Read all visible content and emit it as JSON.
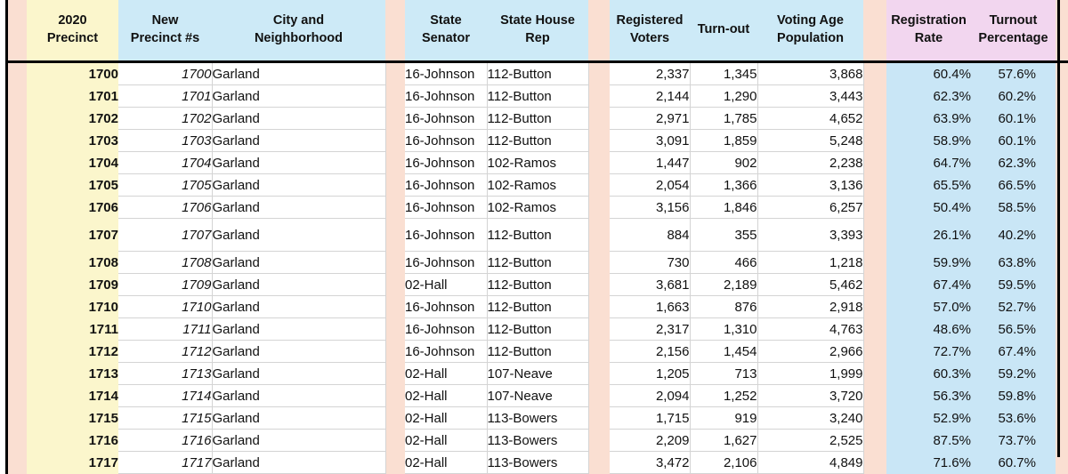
{
  "table": {
    "headers": {
      "precinct_2020": "2020\nPrecinct",
      "precinct_2020_l1": "2020",
      "precinct_2020_l2": "Precinct",
      "new_precinct_l1": "New",
      "new_precinct_l2": "Precinct #s",
      "city_l1": "City and",
      "city_l2": "Neighborhood",
      "state_senator": "State Senator",
      "state_house_rep": "State House Rep",
      "registered_voters_l1": "Registered",
      "registered_voters_l2": "Voters",
      "turnout": "Turn-out",
      "vap_l1": "Voting Age",
      "vap_l2": "Population",
      "registration_rate_l1": "Registration",
      "registration_rate_l2": "Rate",
      "turnout_pct_l1": "Turnout",
      "turnout_pct_l2": "Percentage"
    },
    "columns": [
      "2020 Precinct",
      "New Precinct #s",
      "City and Neighborhood",
      "State Senator",
      "State House Rep",
      "Registered Voters",
      "Turn-out",
      "Voting Age Population",
      "Registration Rate",
      "Turnout Percentage"
    ],
    "rows": [
      {
        "precinct": "1700",
        "new_precinct": "1700",
        "city": "Garland",
        "senator": "16-Johnson",
        "house": "112-Button",
        "registered": "2,337",
        "turnout": "1,345",
        "vap": "3,868",
        "reg_rate": "60.4%",
        "turnout_pct": "57.6%",
        "tall": false
      },
      {
        "precinct": "1701",
        "new_precinct": "1701",
        "city": "Garland",
        "senator": "16-Johnson",
        "house": "112-Button",
        "registered": "2,144",
        "turnout": "1,290",
        "vap": "3,443",
        "reg_rate": "62.3%",
        "turnout_pct": "60.2%",
        "tall": false
      },
      {
        "precinct": "1702",
        "new_precinct": "1702",
        "city": "Garland",
        "senator": "16-Johnson",
        "house": "112-Button",
        "registered": "2,971",
        "turnout": "1,785",
        "vap": "4,652",
        "reg_rate": "63.9%",
        "turnout_pct": "60.1%",
        "tall": false
      },
      {
        "precinct": "1703",
        "new_precinct": "1703",
        "city": "Garland",
        "senator": "16-Johnson",
        "house": "112-Button",
        "registered": "3,091",
        "turnout": "1,859",
        "vap": "5,248",
        "reg_rate": "58.9%",
        "turnout_pct": "60.1%",
        "tall": false
      },
      {
        "precinct": "1704",
        "new_precinct": "1704",
        "city": "Garland",
        "senator": "16-Johnson",
        "house": "102-Ramos",
        "registered": "1,447",
        "turnout": "902",
        "vap": "2,238",
        "reg_rate": "64.7%",
        "turnout_pct": "62.3%",
        "tall": false
      },
      {
        "precinct": "1705",
        "new_precinct": "1705",
        "city": "Garland",
        "senator": "16-Johnson",
        "house": "102-Ramos",
        "registered": "2,054",
        "turnout": "1,366",
        "vap": "3,136",
        "reg_rate": "65.5%",
        "turnout_pct": "66.5%",
        "tall": false
      },
      {
        "precinct": "1706",
        "new_precinct": "1706",
        "city": "Garland",
        "senator": "16-Johnson",
        "house": "102-Ramos",
        "registered": "3,156",
        "turnout": "1,846",
        "vap": "6,257",
        "reg_rate": "50.4%",
        "turnout_pct": "58.5%",
        "tall": false
      },
      {
        "precinct": "1707",
        "new_precinct": "1707",
        "city": "Garland",
        "senator": "16-Johnson",
        "house": "112-Button",
        "registered": "884",
        "turnout": "355",
        "vap": "3,393",
        "reg_rate": "26.1%",
        "turnout_pct": "40.2%",
        "tall": true
      },
      {
        "precinct": "1708",
        "new_precinct": "1708",
        "city": "Garland",
        "senator": "16-Johnson",
        "house": "112-Button",
        "registered": "730",
        "turnout": "466",
        "vap": "1,218",
        "reg_rate": "59.9%",
        "turnout_pct": "63.8%",
        "tall": false
      },
      {
        "precinct": "1709",
        "new_precinct": "1709",
        "city": "Garland",
        "senator": "02-Hall",
        "house": "112-Button",
        "registered": "3,681",
        "turnout": "2,189",
        "vap": "5,462",
        "reg_rate": "67.4%",
        "turnout_pct": "59.5%",
        "tall": false
      },
      {
        "precinct": "1710",
        "new_precinct": "1710",
        "city": "Garland",
        "senator": "16-Johnson",
        "house": "112-Button",
        "registered": "1,663",
        "turnout": "876",
        "vap": "2,918",
        "reg_rate": "57.0%",
        "turnout_pct": "52.7%",
        "tall": false
      },
      {
        "precinct": "1711",
        "new_precinct": "1711",
        "city": "Garland",
        "senator": "16-Johnson",
        "house": "112-Button",
        "registered": "2,317",
        "turnout": "1,310",
        "vap": "4,763",
        "reg_rate": "48.6%",
        "turnout_pct": "56.5%",
        "tall": false
      },
      {
        "precinct": "1712",
        "new_precinct": "1712",
        "city": "Garland",
        "senator": "16-Johnson",
        "house": "112-Button",
        "registered": "2,156",
        "turnout": "1,454",
        "vap": "2,966",
        "reg_rate": "72.7%",
        "turnout_pct": "67.4%",
        "tall": false
      },
      {
        "precinct": "1713",
        "new_precinct": "1713",
        "city": "Garland",
        "senator": "02-Hall",
        "house": "107-Neave",
        "registered": "1,205",
        "turnout": "713",
        "vap": "1,999",
        "reg_rate": "60.3%",
        "turnout_pct": "59.2%",
        "tall": false
      },
      {
        "precinct": "1714",
        "new_precinct": "1714",
        "city": "Garland",
        "senator": "02-Hall",
        "house": "107-Neave",
        "registered": "2,094",
        "turnout": "1,252",
        "vap": "3,720",
        "reg_rate": "56.3%",
        "turnout_pct": "59.8%",
        "tall": false
      },
      {
        "precinct": "1715",
        "new_precinct": "1715",
        "city": "Garland",
        "senator": "02-Hall",
        "house": "113-Bowers",
        "registered": "1,715",
        "turnout": "919",
        "vap": "3,240",
        "reg_rate": "52.9%",
        "turnout_pct": "53.6%",
        "tall": false
      },
      {
        "precinct": "1716",
        "new_precinct": "1716",
        "city": "Garland",
        "senator": "02-Hall",
        "house": "113-Bowers",
        "registered": "2,209",
        "turnout": "1,627",
        "vap": "2,525",
        "reg_rate": "87.5%",
        "turnout_pct": "73.7%",
        "tall": false
      },
      {
        "precinct": "1717",
        "new_precinct": "1717",
        "city": "Garland",
        "senator": "02-Hall",
        "house": "113-Bowers",
        "registered": "3,472",
        "turnout": "2,106",
        "vap": "4,849",
        "reg_rate": "71.6%",
        "turnout_pct": "60.7%",
        "tall": false
      }
    ]
  },
  "colors": {
    "header_blue": "#cdeaf7",
    "header_pink": "#f2d6ef",
    "header_cream": "#fbf6cc",
    "spacer_peach": "#fadfd2",
    "cell_blue": "#c9e6f6",
    "cell_cream": "#fbf6cc",
    "grid_line": "#d4d4d4",
    "frame": "#000000"
  }
}
